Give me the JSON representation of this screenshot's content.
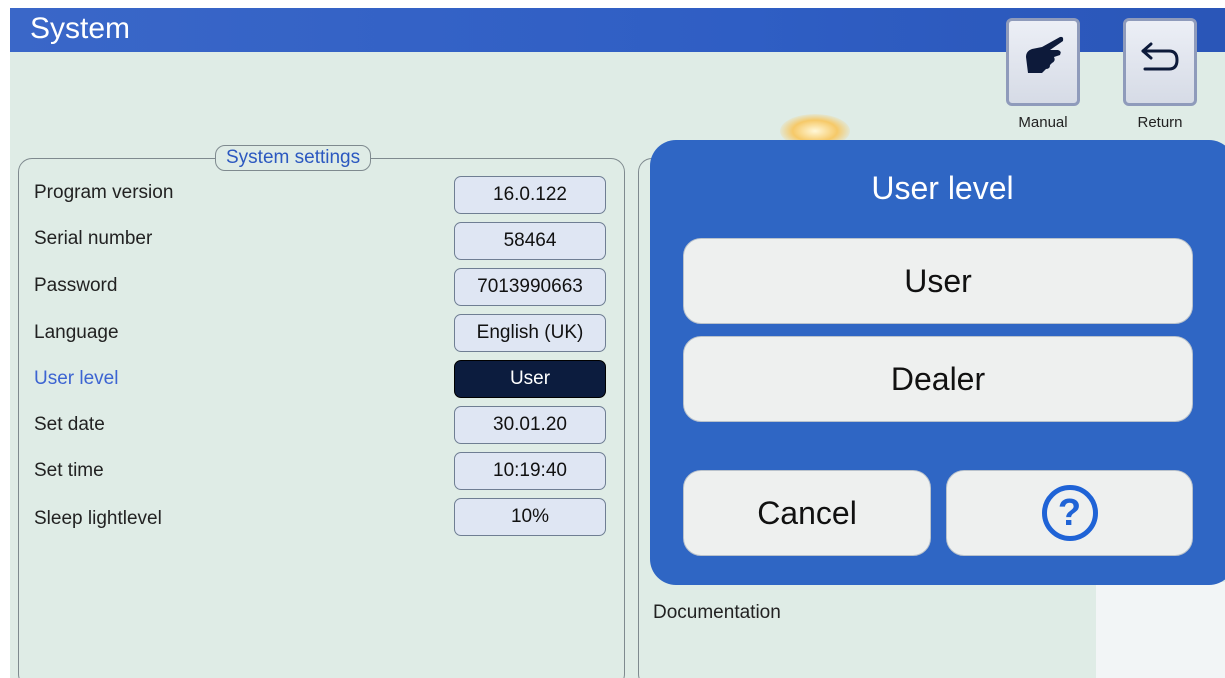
{
  "header": {
    "title": "System",
    "manual_label": "Manual",
    "return_label": "Return",
    "manual_icon": "pointing-hand-icon",
    "return_icon": "return-arrow-icon"
  },
  "settings": {
    "legend": "System settings",
    "rows": [
      {
        "label": "Program version",
        "value": "16.0.122"
      },
      {
        "label": "Serial number",
        "value": "58464"
      },
      {
        "label": "Password",
        "value": "7013990663"
      },
      {
        "label": "Language",
        "value": "English (UK)"
      },
      {
        "label": "User level",
        "value": "User"
      },
      {
        "label": "Set date",
        "value": "30.01.20"
      },
      {
        "label": "Set time",
        "value": "10:19:40"
      },
      {
        "label": "Sleep lightlevel",
        "value": "10%"
      }
    ]
  },
  "right_panel": {
    "documentation_label": "Documentation"
  },
  "dialog": {
    "title": "User level",
    "options": [
      "User",
      "Dealer"
    ],
    "cancel_label": "Cancel",
    "help_symbol": "?",
    "help_icon": "help-question-icon"
  },
  "colors": {
    "title_bar": "#2f5ec4",
    "dialog_bg": "#2f66c4",
    "selected_field": "#0c1c3e",
    "active_label": "#3c64d2",
    "screen_bg": "#dfece6"
  }
}
